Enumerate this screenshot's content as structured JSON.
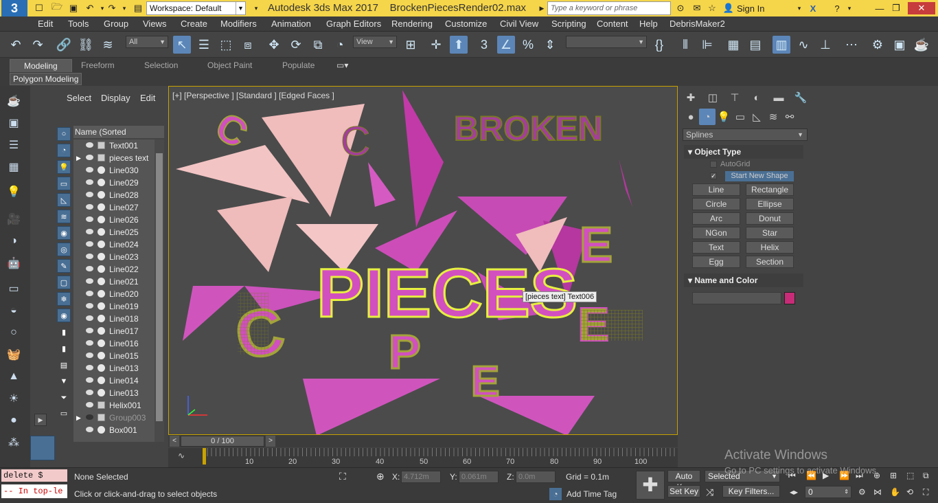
{
  "titlebar": {
    "workspace": "Workspace: Default",
    "title": "Autodesk 3ds Max 2017",
    "filename": "BrockenPiecesRender02.max",
    "search_placeholder": "Type a keyword or phrase",
    "sign_in": "Sign In"
  },
  "menu": [
    "Edit",
    "Tools",
    "Group",
    "Views",
    "Create",
    "Modifiers",
    "Animation",
    "Graph Editors",
    "Rendering",
    "Customize",
    "Civil View",
    "Scripting",
    "Content",
    "Help",
    "DebrisMaker2"
  ],
  "toolbar": {
    "selection_filter": "All",
    "ref_coord": "View"
  },
  "ribbon": {
    "tabs": [
      "Modeling",
      "Freeform",
      "Selection",
      "Object Paint",
      "Populate"
    ],
    "panel_label": "Polygon Modeling"
  },
  "scene_explorer": {
    "tabs": [
      "Select",
      "Display",
      "Edit"
    ],
    "column_header": "Name (Sorted Descending)",
    "rows": [
      {
        "name": "Text001",
        "type": "group",
        "arrow": false,
        "dim": false
      },
      {
        "name": "pieces text",
        "type": "group",
        "arrow": true,
        "dim": false
      },
      {
        "name": "Line030",
        "type": "shape",
        "arrow": false,
        "dim": false
      },
      {
        "name": "Line029",
        "type": "shape",
        "arrow": false,
        "dim": false
      },
      {
        "name": "Line028",
        "type": "shape",
        "arrow": false,
        "dim": false
      },
      {
        "name": "Line027",
        "type": "shape",
        "arrow": false,
        "dim": false
      },
      {
        "name": "Line026",
        "type": "shape",
        "arrow": false,
        "dim": false
      },
      {
        "name": "Line025",
        "type": "shape",
        "arrow": false,
        "dim": false
      },
      {
        "name": "Line024",
        "type": "shape",
        "arrow": false,
        "dim": false
      },
      {
        "name": "Line023",
        "type": "shape",
        "arrow": false,
        "dim": false
      },
      {
        "name": "Line022",
        "type": "shape",
        "arrow": false,
        "dim": false
      },
      {
        "name": "Line021",
        "type": "shape",
        "arrow": false,
        "dim": false
      },
      {
        "name": "Line020",
        "type": "shape",
        "arrow": false,
        "dim": false
      },
      {
        "name": "Line019",
        "type": "shape",
        "arrow": false,
        "dim": false
      },
      {
        "name": "Line018",
        "type": "shape",
        "arrow": false,
        "dim": false
      },
      {
        "name": "Line017",
        "type": "shape",
        "arrow": false,
        "dim": false
      },
      {
        "name": "Line016",
        "type": "shape",
        "arrow": false,
        "dim": false
      },
      {
        "name": "Line015",
        "type": "shape",
        "arrow": false,
        "dim": false
      },
      {
        "name": "Line013",
        "type": "shape",
        "arrow": false,
        "dim": false
      },
      {
        "name": "Line014",
        "type": "shape",
        "arrow": false,
        "dim": false
      },
      {
        "name": "Line013",
        "type": "shape",
        "arrow": false,
        "dim": false
      },
      {
        "name": "Helix001",
        "type": "group",
        "arrow": false,
        "dim": false
      },
      {
        "name": "Group003",
        "type": "group",
        "arrow": true,
        "dim": true
      },
      {
        "name": "Box001",
        "type": "shape",
        "arrow": false,
        "dim": false
      }
    ]
  },
  "viewport": {
    "label": "[+] [Perspective ] [Standard ] [Edged Faces ]",
    "tooltip": "[pieces text] Text006",
    "text_broken": "BROKEN",
    "text_pieces": "PIECES",
    "frag_letters": [
      "C",
      "E",
      "C",
      "P",
      "E",
      "C"
    ],
    "colors": {
      "magenta": "#d24fc0",
      "pink": "#f0bcbc",
      "olive": "#a3a33a",
      "selection": "#e6f040"
    }
  },
  "command_panel": {
    "category": "Splines",
    "object_type_title": "Object Type",
    "autogrid": "AutoGrid",
    "start_new_shape": "Start New Shape",
    "buttons": [
      "Line",
      "Rectangle",
      "Circle",
      "Ellipse",
      "Arc",
      "Donut",
      "NGon",
      "Star",
      "Text",
      "Helix",
      "Egg",
      "Section"
    ],
    "name_color_title": "Name and Color",
    "object_color": "#c82c78"
  },
  "timeline": {
    "slider": "0 / 100",
    "ticks": [
      "10",
      "20",
      "30",
      "40",
      "50",
      "60",
      "70",
      "80",
      "90",
      "100"
    ]
  },
  "status": {
    "maxscript_line1": "delete $",
    "maxscript_line2": "-- In top-le",
    "selection": "None Selected",
    "prompt": "Click or click-and-drag to select objects",
    "x_label": "X:",
    "x_value": "4.712m",
    "y_label": "Y:",
    "y_value": "0.061m",
    "z_label": "Z:",
    "z_value": "0.0m",
    "grid": "Grid = 0.1m",
    "add_time_tag": "Add Time Tag",
    "auto_key": "Auto Key",
    "set_key": "Set Key",
    "selected": "Selected",
    "key_filters": "Key Filters...",
    "frame": "0"
  },
  "watermark": {
    "line1": "Activate Windows",
    "line2": "Go to PC settings to activate Windows."
  }
}
